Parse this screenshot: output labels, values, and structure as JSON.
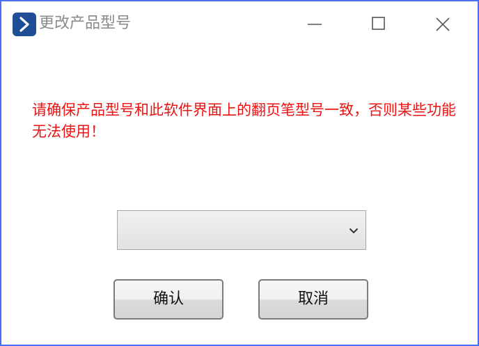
{
  "window": {
    "title": "更改产品型号",
    "title_color": "#8a8a8a",
    "border_color": "#4a6cf7",
    "icon": "chevron-right-app-icon",
    "controls": {
      "minimize_icon": "minimize-icon",
      "maximize_icon": "maximize-icon",
      "close_icon": "close-icon"
    }
  },
  "dialog": {
    "warning_text": "请确保产品型号和此软件界面上的翻页笔型号一致，否则某些功能无法使用！",
    "warning_color": "#ee1111",
    "model_select": {
      "selected_value": "",
      "arrow_icon": "chevron-down-icon"
    },
    "buttons": {
      "confirm_label": "确认",
      "cancel_label": "取消"
    }
  }
}
